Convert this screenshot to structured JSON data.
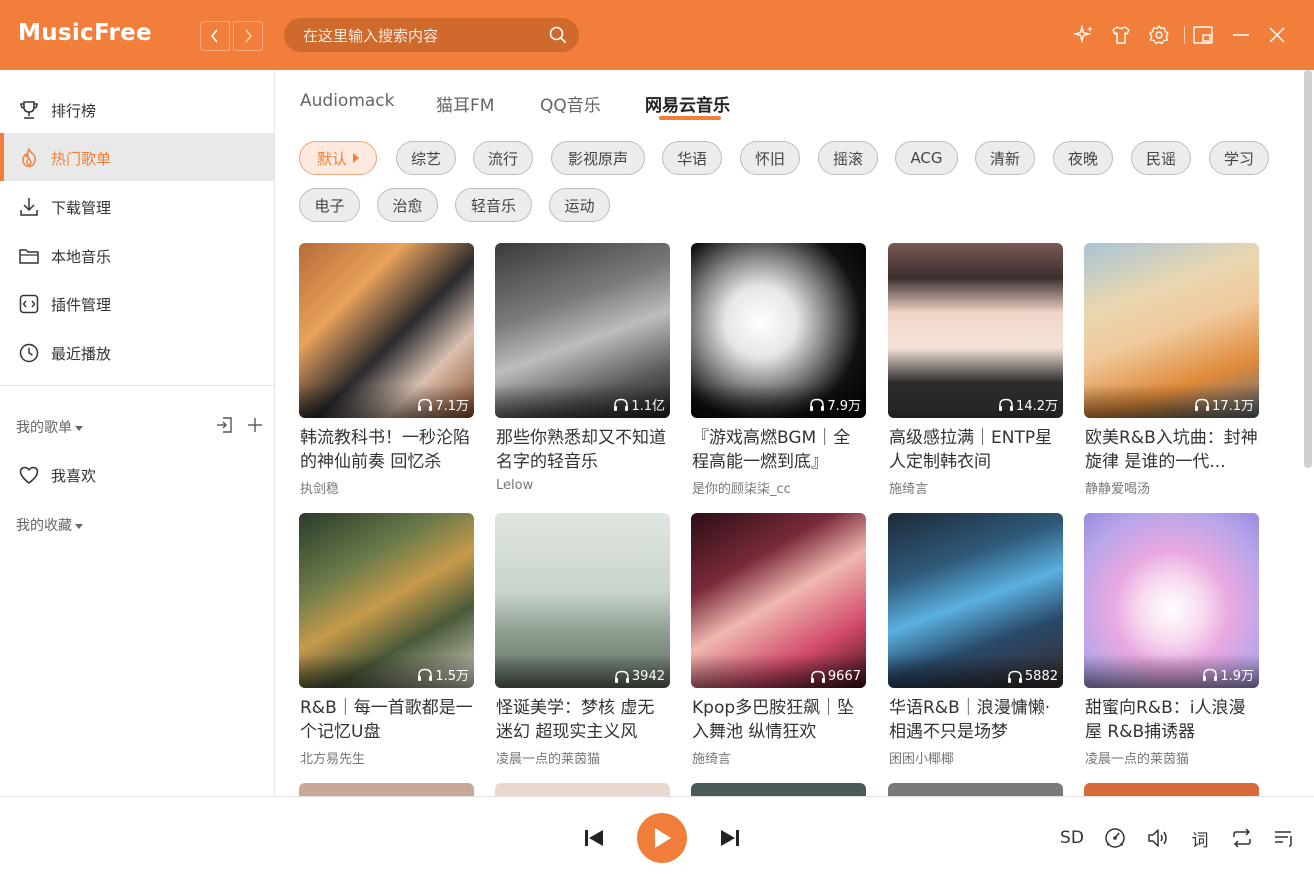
{
  "app": {
    "title": "MusicFree",
    "accent_color": "#f17f3b"
  },
  "header": {
    "back_icon": "chevron-left-icon",
    "forward_icon": "chevron-right-icon",
    "search_placeholder": "在这里输入搜索内容",
    "icons": [
      "sparkle-icon",
      "tshirt-icon",
      "gear-icon",
      "minimize-to-mini-icon",
      "minimize-icon",
      "close-icon"
    ]
  },
  "sidebar": {
    "items": [
      {
        "label": "排行榜",
        "icon": "trophy-icon"
      },
      {
        "label": "热门歌单",
        "icon": "flame-icon",
        "active": true
      },
      {
        "label": "下载管理",
        "icon": "download-icon"
      },
      {
        "label": "本地音乐",
        "icon": "folder-icon"
      },
      {
        "label": "插件管理",
        "icon": "plugin-icon"
      },
      {
        "label": "最近播放",
        "icon": "clock-icon"
      }
    ],
    "my_playlists_label": "我的歌单",
    "favorites_label": "我喜欢",
    "my_collections_label": "我的收藏"
  },
  "tabs": [
    "Audiomack",
    "猫耳FM",
    "QQ音乐",
    "网易云音乐"
  ],
  "active_tab": "网易云音乐",
  "tags": [
    "默认",
    "综艺",
    "流行",
    "影视原声",
    "华语",
    "怀旧",
    "摇滚",
    "ACG",
    "清新",
    "夜晚",
    "民谣",
    "学习",
    "电子",
    "治愈",
    "轻音乐",
    "运动"
  ],
  "active_tag": "默认",
  "playlists": [
    {
      "title": "韩流教科书！一秒沦陷的神仙前奏 回忆杀",
      "author": "执剑稳",
      "plays": "7.1万"
    },
    {
      "title": "那些你熟悉却又不知道名字的轻音乐",
      "author": "Lelow",
      "plays": "1.1亿"
    },
    {
      "title": "『游戏高燃BGM｜全程高能一燃到底』",
      "author": "是你的顾柒柒_cc",
      "plays": "7.9万"
    },
    {
      "title": "高级感拉满｜ENTP星人定制韩衣间",
      "author": "施绮言",
      "plays": "14.2万"
    },
    {
      "title": "欧美R&B入坑曲：封神旋律 是谁的一代...",
      "author": "静静爱喝汤",
      "plays": "17.1万"
    },
    {
      "title": "R&B｜每一首歌都是一个记忆U盘",
      "author": "北方易先生",
      "plays": "1.5万"
    },
    {
      "title": "怪诞美学：梦核 虚无迷幻 超现实主义风",
      "author": "凌晨一点的莱茵猫",
      "plays": "3942"
    },
    {
      "title": "Kpop多巴胺狂飙｜坠入舞池 纵情狂欢",
      "author": "施绮言",
      "plays": "9667"
    },
    {
      "title": "华语R&B｜浪漫慵懒·相遇不只是场梦",
      "author": "困困小椰椰",
      "plays": "5882"
    },
    {
      "title": "甜蜜向R&B：i人浪漫屋 R&B捕诱器",
      "author": "凌晨一点的莱茵猫",
      "plays": "1.9万"
    }
  ],
  "player": {
    "quality_label": "SD",
    "lyrics_label": "词",
    "icons": [
      "prev-icon",
      "play-icon",
      "next-icon",
      "sound-effect-icon",
      "volume-icon",
      "repeat-icon",
      "playlist-icon"
    ]
  }
}
